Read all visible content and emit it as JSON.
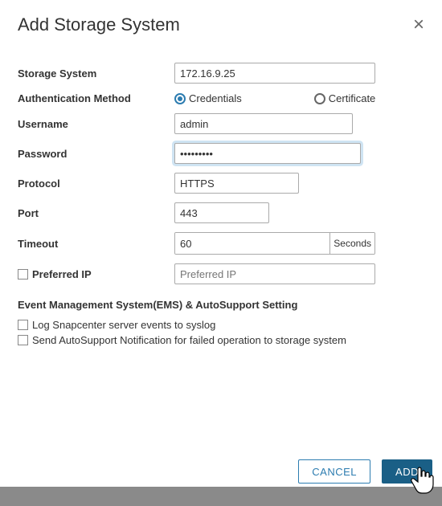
{
  "dialog": {
    "title": "Add Storage System"
  },
  "form": {
    "storage_system": {
      "label": "Storage System",
      "value": "172.16.9.25"
    },
    "auth_method": {
      "label": "Authentication Method",
      "options": {
        "credentials": "Credentials",
        "certificate": "Certificate"
      },
      "selected": "credentials"
    },
    "username": {
      "label": "Username",
      "value": "admin"
    },
    "password": {
      "label": "Password",
      "value": "•••••••••"
    },
    "protocol": {
      "label": "Protocol",
      "value": "HTTPS"
    },
    "port": {
      "label": "Port",
      "value": "443"
    },
    "timeout": {
      "label": "Timeout",
      "value": "60",
      "unit": "Seconds"
    },
    "preferred_ip": {
      "label": "Preferred IP",
      "placeholder": "Preferred IP",
      "checked": false
    }
  },
  "ems": {
    "section_title": "Event Management System(EMS) & AutoSupport Setting",
    "log_syslog": {
      "label": "Log Snapcenter server events to syslog",
      "checked": false
    },
    "autosupport": {
      "label": "Send AutoSupport Notification for failed operation to storage system",
      "checked": false
    }
  },
  "buttons": {
    "cancel": "CANCEL",
    "add": "ADD"
  }
}
